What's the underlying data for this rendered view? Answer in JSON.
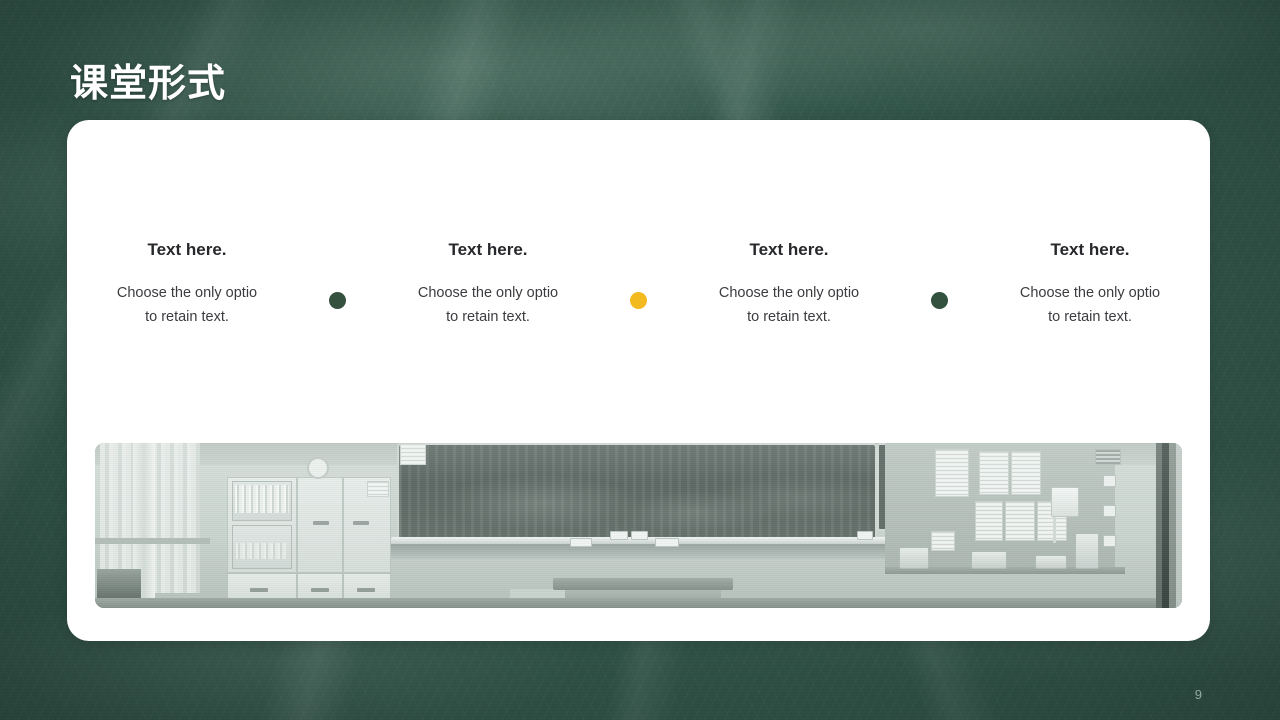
{
  "slide": {
    "title": "课堂形式",
    "page_number": "9",
    "background_color": "#33564a",
    "card_color": "#ffffff"
  },
  "columns": [
    {
      "heading": "Text here.",
      "line1": "Choose the only optio",
      "line2": "to retain text."
    },
    {
      "heading": "Text here.",
      "line1": "Choose the only optio",
      "line2": "to retain text."
    },
    {
      "heading": "Text here.",
      "line1": "Choose the only optio",
      "line2": "to retain text."
    },
    {
      "heading": "Text here.",
      "line1": "Choose the only optio",
      "line2": "to retain text."
    }
  ],
  "dots": [
    {
      "color": "#34503f"
    },
    {
      "color": "#f2ba1e"
    },
    {
      "color": "#34503f"
    }
  ],
  "photo": {
    "caption": "classroom-photograph",
    "description": "Black and white classroom interior with chalkboard, cabinets and bulletin board"
  }
}
